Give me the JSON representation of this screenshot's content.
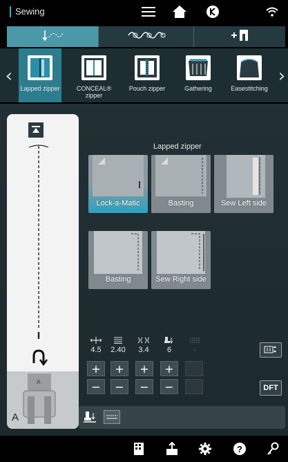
{
  "topbar": {
    "title": "Sewing"
  },
  "techniques": [
    {
      "label": "Lapped zipper",
      "selected": true
    },
    {
      "label": "CONCEAL® zipper",
      "selected": false
    },
    {
      "label": "Pouch zipper",
      "selected": false
    },
    {
      "label": "Gathering",
      "selected": false
    },
    {
      "label": "Easestitching",
      "selected": false
    }
  ],
  "steps": {
    "title": "Lapped zipper",
    "items": [
      {
        "label": "Lock-a-Matic",
        "active": true
      },
      {
        "label": "Basting",
        "active": false
      },
      {
        "label": "Sew Left side",
        "active": false
      },
      {
        "label": "Basting",
        "active": false
      },
      {
        "label": "Sew Right side",
        "active": false
      }
    ]
  },
  "stitch_panel": {
    "foot_letter": "A"
  },
  "params": [
    {
      "name": "stitch-width",
      "icon": "stitch-width-icon",
      "value": "4.5"
    },
    {
      "name": "stitch-length",
      "icon": "stitch-length-icon",
      "value": "2.40"
    },
    {
      "name": "thread-tension",
      "icon": "thread-tension-icon",
      "value": "3.4"
    },
    {
      "name": "presser-foot-pressure",
      "icon": "presser-foot-pressure-icon",
      "value": "6"
    },
    {
      "name": "stitch-density",
      "icon": "stitch-density-icon",
      "value": "-"
    }
  ],
  "side_buttons": {
    "dft_label": "DFT"
  },
  "colors": {
    "accent": "#2fb4c6",
    "selected_tab": "#4a98a8",
    "panel_bg": "#1c2a2e"
  }
}
